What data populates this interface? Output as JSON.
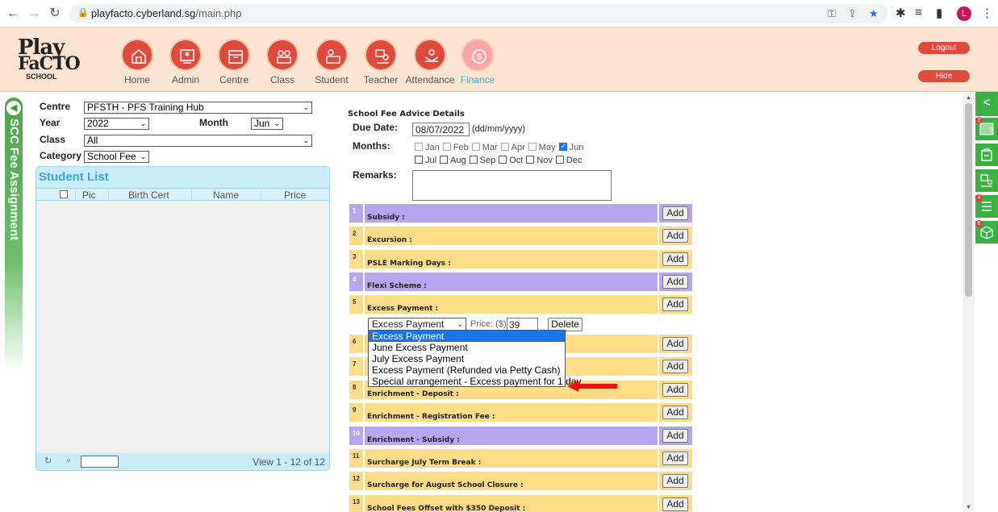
{
  "browser": {
    "url_host": "playfacto.cyberland.sg",
    "url_path": "/main.php",
    "avatar_letter": "L"
  },
  "logo": {
    "line1": "Play",
    "line2": "FaCTO",
    "line3": "SCHOOL"
  },
  "nav": [
    {
      "label": "Home",
      "icon": "home-icon"
    },
    {
      "label": "Admin",
      "icon": "admin-icon"
    },
    {
      "label": "Centre",
      "icon": "centre-icon"
    },
    {
      "label": "Class",
      "icon": "class-icon"
    },
    {
      "label": "Student",
      "icon": "student-icon"
    },
    {
      "label": "Teacher",
      "icon": "teacher-icon"
    },
    {
      "label": "Attendance",
      "icon": "attendance-icon"
    },
    {
      "label": "Finance",
      "icon": "finance-icon",
      "active": true
    }
  ],
  "header_buttons": {
    "logout": "Logout",
    "hide": "Hide"
  },
  "side_tab": "SCC Fee Assignment",
  "filters": {
    "centre_label": "Centre",
    "centre_value": "PFSTH - PFS Training Hub",
    "year_label": "Year",
    "year_value": "2022",
    "month_label": "Month",
    "month_value": "Jun",
    "class_label": "Class",
    "class_value": "All",
    "category_label": "Category",
    "category_value": "School Fee"
  },
  "student_list": {
    "title": "Student List",
    "columns": [
      "Pic",
      "Birth Cert",
      "Name",
      "Price"
    ],
    "footer": "View 1 - 12 of 12"
  },
  "fee_advice": {
    "title": "School Fee Advice Details",
    "due_date_label": "Due Date:",
    "due_date_value": "08/07/2022",
    "due_date_format": "(dd/mm/yyyy)",
    "months_label": "Months:",
    "months_row1": [
      {
        "name": "Jan",
        "checked": false
      },
      {
        "name": "Feb",
        "checked": false
      },
      {
        "name": "Mar",
        "checked": false
      },
      {
        "name": "Apr",
        "checked": false
      },
      {
        "name": "May",
        "checked": false
      },
      {
        "name": "Jun",
        "checked": true
      }
    ],
    "months_row2": [
      {
        "name": "Jul",
        "checked": false
      },
      {
        "name": "Aug",
        "checked": false
      },
      {
        "name": "Sep",
        "checked": false
      },
      {
        "name": "Oct",
        "checked": false
      },
      {
        "name": "Nov",
        "checked": false
      },
      {
        "name": "Dec",
        "checked": false
      }
    ],
    "remarks_label": "Remarks:",
    "add_label": "Add",
    "rows": [
      {
        "num": "1",
        "label": "Subsidy :",
        "color": "purple"
      },
      {
        "num": "2",
        "label": "Excursion :",
        "color": "yellow"
      },
      {
        "num": "3",
        "label": "PSLE Marking Days :",
        "color": "yellow"
      },
      {
        "num": "4",
        "label": "Flexi Scheme :",
        "color": "purple"
      },
      {
        "num": "5",
        "label": "Excess Payment :",
        "color": "yellow"
      },
      {
        "num": "6",
        "label": "",
        "color": "yellow"
      },
      {
        "num": "7",
        "label": "",
        "color": "yellow"
      },
      {
        "num": "8",
        "label": "Enrichment - Deposit :",
        "color": "yellow"
      },
      {
        "num": "9",
        "label": "Enrichment - Registration Fee :",
        "color": "yellow"
      },
      {
        "num": "10",
        "label": "Enrichment - Subsidy :",
        "color": "purple"
      },
      {
        "num": "11",
        "label": "Surcharge July Term Break :",
        "color": "yellow"
      },
      {
        "num": "12",
        "label": "Surcharge for August School Closure :",
        "color": "yellow"
      },
      {
        "num": "13",
        "label": "School Fees Offset with $350 Deposit :",
        "color": "yellow"
      }
    ],
    "excess": {
      "selected": "Excess Payment",
      "price_label": "Price: ($)",
      "price_value": "39",
      "delete_label": "Delete",
      "options": [
        "Excess Payment",
        "June Excess Payment",
        "July Excess Payment",
        "Excess Payment (Refunded via Petty Cash)",
        "Special arrangement - Excess payment for 1 day"
      ]
    }
  },
  "right_sidebar": {
    "badges": [
      "2",
      "4",
      "6"
    ]
  },
  "colors": {
    "accent_red": "#e04a3a",
    "header_bg": "#fde4d0",
    "row_yellow": "#fddc87",
    "row_purple": "#b6a6f0",
    "finance_blue": "#2ab7e0"
  }
}
